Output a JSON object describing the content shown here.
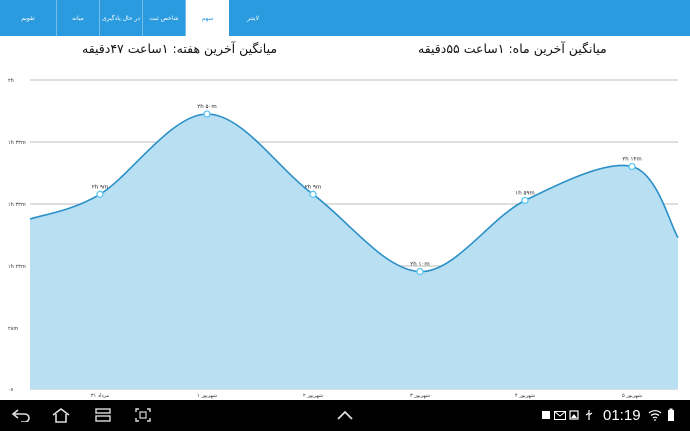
{
  "tabs": [
    {
      "label": "تقویم",
      "active": false
    },
    {
      "label": "میانه",
      "active": false
    },
    {
      "label": "در حال یادگیری",
      "active": false
    },
    {
      "label": "شاخص ثبت",
      "active": false
    },
    {
      "label": "سهم",
      "active": true
    },
    {
      "label": "لایتنر",
      "active": false
    }
  ],
  "header": {
    "week_avg": "میانگین آخرین هفته: ۱ساعت  ۴۷دقیقه",
    "month_avg": "میانگین آخرین ماه: ۱ساعت  ۵۵دقیقه"
  },
  "chart_data": {
    "type": "area",
    "y_ticks": [
      "۰s",
      "۲۸m",
      "۱h ۲۳m",
      "۱h ۳۳m",
      "۱h ۳۳m",
      "۲h"
    ],
    "x": [
      "۳۱ مرداد",
      "۱ شهریور",
      "۲ شهریور",
      "۳ شهریور",
      "۴ شهریور",
      "۵ شهریور"
    ],
    "points": [
      {
        "x": "۳۱ مرداد",
        "label": "۲h ۹m"
      },
      {
        "x": "۱ شهریور",
        "label": "۲h ۵۰m"
      },
      {
        "x": "۲ شهریور",
        "label": "۲h ۹m"
      },
      {
        "x": "۳ شهریور",
        "label": "۲h ۱۰m"
      },
      {
        "x": "۴ شهریور",
        "label": "۱h ۵۹m"
      },
      {
        "x": "۵ شهریور",
        "label": "۲h ۱۴m"
      }
    ],
    "values": [
      0.63,
      0.89,
      0.63,
      0.38,
      0.61,
      0.72
    ],
    "start_value": 0.55,
    "end_value": 0.49,
    "fill_color": "#b9dff3",
    "line_color": "#2b90c8"
  },
  "navbar": {
    "time": "01:19",
    "icons": [
      "back-icon",
      "home-icon",
      "recent-apps-icon",
      "screenshot-icon",
      "up-chevron-icon",
      "image-icon",
      "mail-icon",
      "gallery-icon",
      "usb-icon",
      "wifi-icon",
      "battery-icon"
    ]
  }
}
